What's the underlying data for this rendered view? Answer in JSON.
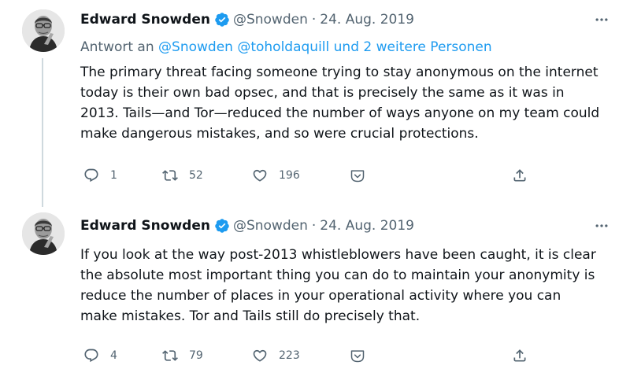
{
  "tweets": [
    {
      "author_name": "Edward Snowden",
      "handle": "@Snowden",
      "separator": "·",
      "date": "24. Aug. 2019",
      "reply_prefix": "Antwort an",
      "reply_handles": "@Snowden @toholdaquill und 2 weitere Personen",
      "text": "The primary threat facing someone trying to stay anonymous on the internet today is their own bad opsec, and that is precisely the same as it was in 2013. Tails—and Tor—reduced the number of ways anyone on my team could make dangerous mistakes, and so were crucial protections.",
      "reply_count": "1",
      "retweet_count": "52",
      "like_count": "196"
    },
    {
      "author_name": "Edward Snowden",
      "handle": "@Snowden",
      "separator": "·",
      "date": "24. Aug. 2019",
      "text": "If you look at the way post-2013 whistleblowers have been caught, it is clear the absolute most important thing you can do to maintain your anonymity is reduce the number of places in your operational activity where you can make mistakes. Tor and Tails still do precisely that.",
      "reply_count": "4",
      "retweet_count": "79",
      "like_count": "223"
    }
  ],
  "icons": {
    "more": "more-icon",
    "verified": "verified-badge-icon",
    "reply": "reply-icon",
    "retweet": "retweet-icon",
    "like": "heart-icon",
    "downvote": "downvote-icon",
    "share": "share-icon"
  },
  "colors": {
    "accent": "#1d9bf0",
    "text": "#0f1419",
    "secondary": "#536471",
    "thread_line": "#cfd9de"
  }
}
